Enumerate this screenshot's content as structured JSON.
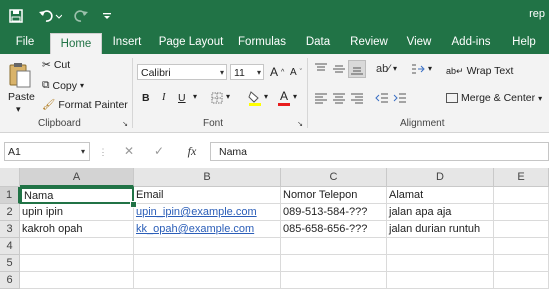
{
  "window": {
    "title": "rep"
  },
  "ribbon_tabs": [
    {
      "label": "File"
    },
    {
      "label": "Home"
    },
    {
      "label": "Insert"
    },
    {
      "label": "Page Layout"
    },
    {
      "label": "Formulas"
    },
    {
      "label": "Data"
    },
    {
      "label": "Review"
    },
    {
      "label": "View"
    },
    {
      "label": "Add-ins"
    },
    {
      "label": "Help"
    }
  ],
  "clipboard": {
    "paste": "Paste",
    "cut": "Cut",
    "copy": "Copy",
    "format_painter": "Format Painter",
    "label": "Clipboard"
  },
  "font": {
    "name": "Calibri",
    "size": "11",
    "bold": "B",
    "italic": "I",
    "underline": "U",
    "label": "Font",
    "grow": "A",
    "shrink": "A",
    "color_letter": "A"
  },
  "alignment": {
    "wrap_text": "Wrap Text",
    "merge_center": "Merge & Center",
    "label": "Alignment"
  },
  "formula_bar": {
    "name_box": "A1",
    "fx": "fx",
    "cancel": "✕",
    "enter": "✓",
    "value": "Nama"
  },
  "grid": {
    "columns": [
      "A",
      "B",
      "C",
      "D",
      "E"
    ],
    "rows": [
      "1",
      "2",
      "3",
      "4",
      "5",
      "6"
    ],
    "cells": [
      [
        "Nama",
        "Email",
        "Nomor Telepon",
        "Alamat",
        ""
      ],
      [
        "upin ipin",
        "upin_ipin@example.com",
        "089-513-584-???",
        "jalan apa aja",
        ""
      ],
      [
        "kakroh opah",
        "kk_opah@example.com",
        "085-658-656-???",
        "jalan durian runtuh",
        ""
      ],
      [
        "",
        "",
        "",
        "",
        ""
      ],
      [
        "",
        "",
        "",
        "",
        ""
      ],
      [
        "",
        "",
        "",
        "",
        ""
      ]
    ]
  },
  "colors": {
    "accent": "#217346",
    "link": "#2b5eb8"
  }
}
